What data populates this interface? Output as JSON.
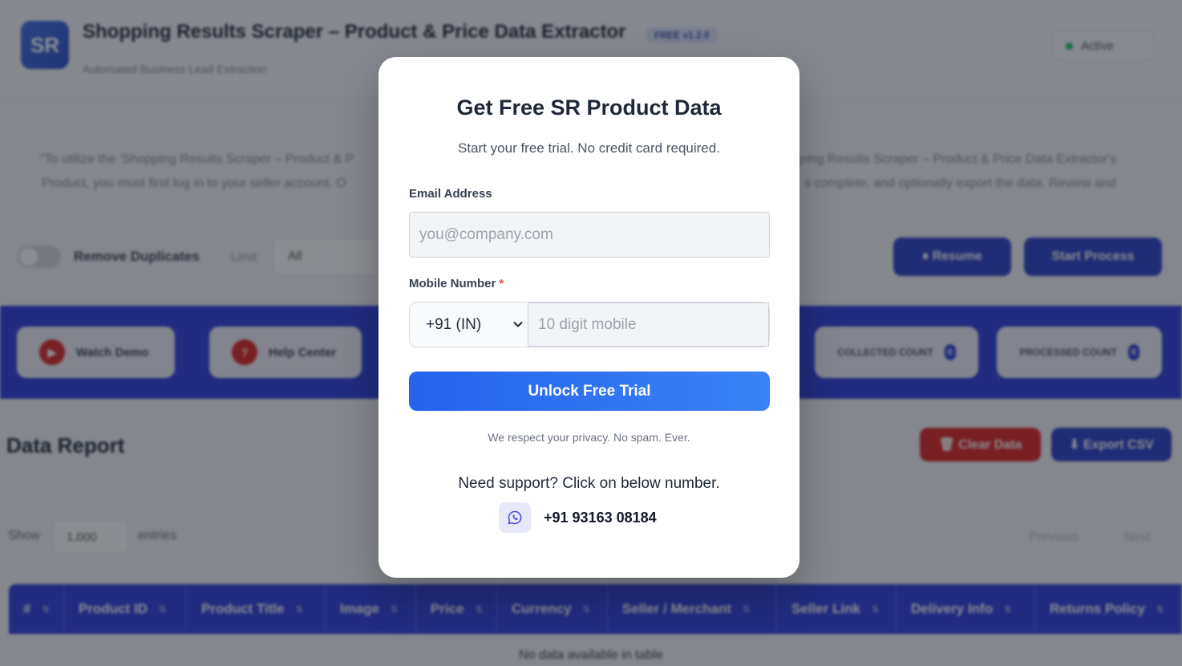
{
  "app": {
    "logo_text": "SR",
    "title": "Shopping Results Scraper – Product & Price Data Extractor",
    "version_badge": "FREE v1.2.0",
    "subtitle": "Automated Business Lead Extraction",
    "status": "Active",
    "status_color": "#22c55e",
    "description_line1_left": "\"To utilize the 'Shopping Results Scraper – Product & P",
    "description_line1_right": "ping Results Scraper – Product & Price Data Extractor's",
    "description_line2_left": "Product, you must first log in to your seller account. O",
    "description_line2_right": "s complete, and optionally export the data. Review and"
  },
  "controls": {
    "remove_duplicates_label": "Remove Duplicates",
    "limit_label": "Limit:",
    "limit_value": "All",
    "resume_button": "⏸ Resume",
    "start_button": "Start Process"
  },
  "actions_band": {
    "watch_demo": "Watch Demo",
    "help_center": "Help Center",
    "collected_count_label": "COLLECTED COUNT",
    "collected_count": "0",
    "processed_count_label": "PROCESSED COUNT",
    "processed_count": "0",
    "band_color": "#2f3ddb"
  },
  "report": {
    "title": "Data Report",
    "clear_button": "🗑 Clear Data",
    "export_button": "⬇ Export CSV",
    "show_label": "Show",
    "entries_value": "1,000",
    "entries_label": "entries",
    "previous": "Previous",
    "next": "Next",
    "columns": [
      "#",
      "Product ID",
      "Product Title",
      "Image",
      "Price",
      "Currency",
      "Seller / Merchant",
      "Seller Link",
      "Delivery Info",
      "Returns Policy"
    ],
    "empty_message": "No data available in table"
  },
  "modal": {
    "title": "Get Free SR Product Data",
    "subtitle": "Start your free trial. No credit card required.",
    "email_label": "Email Address",
    "email_placeholder": "you@company.com",
    "mobile_label": "Mobile Number",
    "required_mark": "*",
    "country_code": "+91 (IN)",
    "mobile_placeholder": "10 digit mobile",
    "submit_button": "Unlock Free Trial",
    "privacy_note": "We respect your privacy. No spam. Ever.",
    "support_text": "Need support? Click on below number.",
    "support_phone": "+91 93163 08184",
    "support_icon": "whatsapp-icon",
    "accent_color": "#2563eb"
  }
}
